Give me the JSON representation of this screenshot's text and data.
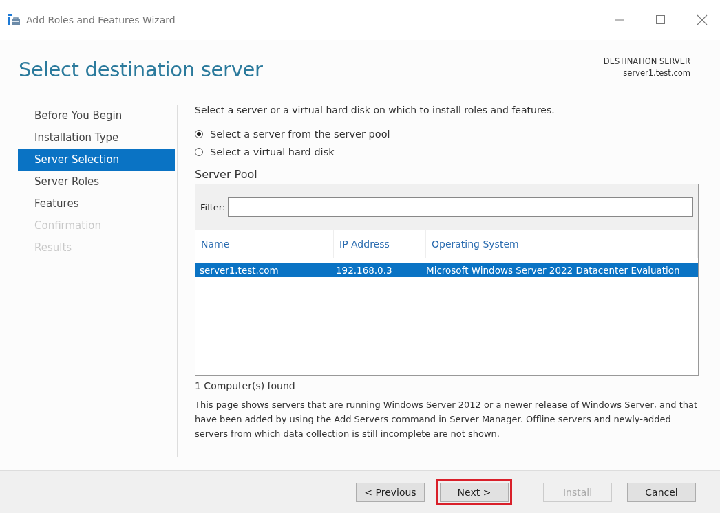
{
  "window": {
    "title": "Add Roles and Features Wizard"
  },
  "page_title": "Select destination server",
  "destination": {
    "label": "DESTINATION SERVER",
    "server": "server1.test.com"
  },
  "steps": [
    {
      "label": "Before You Begin",
      "selected": false,
      "disabled": false
    },
    {
      "label": "Installation Type",
      "selected": false,
      "disabled": false
    },
    {
      "label": "Server Selection",
      "selected": true,
      "disabled": false
    },
    {
      "label": "Server Roles",
      "selected": false,
      "disabled": false
    },
    {
      "label": "Features",
      "selected": false,
      "disabled": false
    },
    {
      "label": "Confirmation",
      "selected": false,
      "disabled": true
    },
    {
      "label": "Results",
      "selected": false,
      "disabled": true
    }
  ],
  "intro": "Select a server or a virtual hard disk on which to install roles and features.",
  "options": [
    {
      "label": "Select a server from the server pool",
      "selected": true
    },
    {
      "label": "Select a virtual hard disk",
      "selected": false
    }
  ],
  "server_pool": {
    "title": "Server Pool",
    "filter_label": "Filter:",
    "columns": [
      "Name",
      "IP Address",
      "Operating System"
    ],
    "rows": [
      {
        "cells": [
          "server1.test.com",
          "192.168.0.3",
          "Microsoft Windows Server 2022 Datacenter Evaluation"
        ],
        "selected": true
      }
    ],
    "count": "1 Computer(s) found"
  },
  "note": "This page shows servers that are running Windows Server 2012 or a newer release of Windows Server, and that have been added by using the Add Servers command in Server Manager. Offline servers and newly-added servers from which data collection is still incomplete are not shown.",
  "buttons": [
    {
      "label": "< Previous",
      "disabled": false,
      "highlighted": false
    },
    {
      "label": "Next >",
      "disabled": false,
      "highlighted": true
    },
    {
      "label": "Install",
      "disabled": true,
      "highlighted": false
    },
    {
      "label": "Cancel",
      "disabled": false,
      "highlighted": false
    }
  ]
}
